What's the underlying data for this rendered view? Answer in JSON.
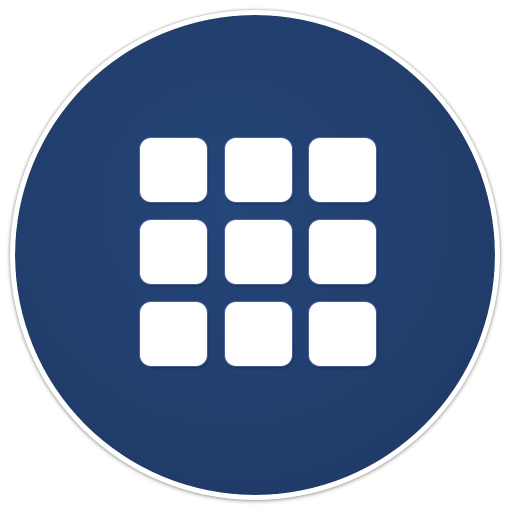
{
  "icon": {
    "name": "app-grid-icon",
    "colors": {
      "circle_fill": "#1f3a66",
      "circle_fill_highlight": "#25467a",
      "ring": "#ffffff",
      "tiles": "#ffffff"
    },
    "grid": {
      "rows": 3,
      "columns": 3
    }
  }
}
